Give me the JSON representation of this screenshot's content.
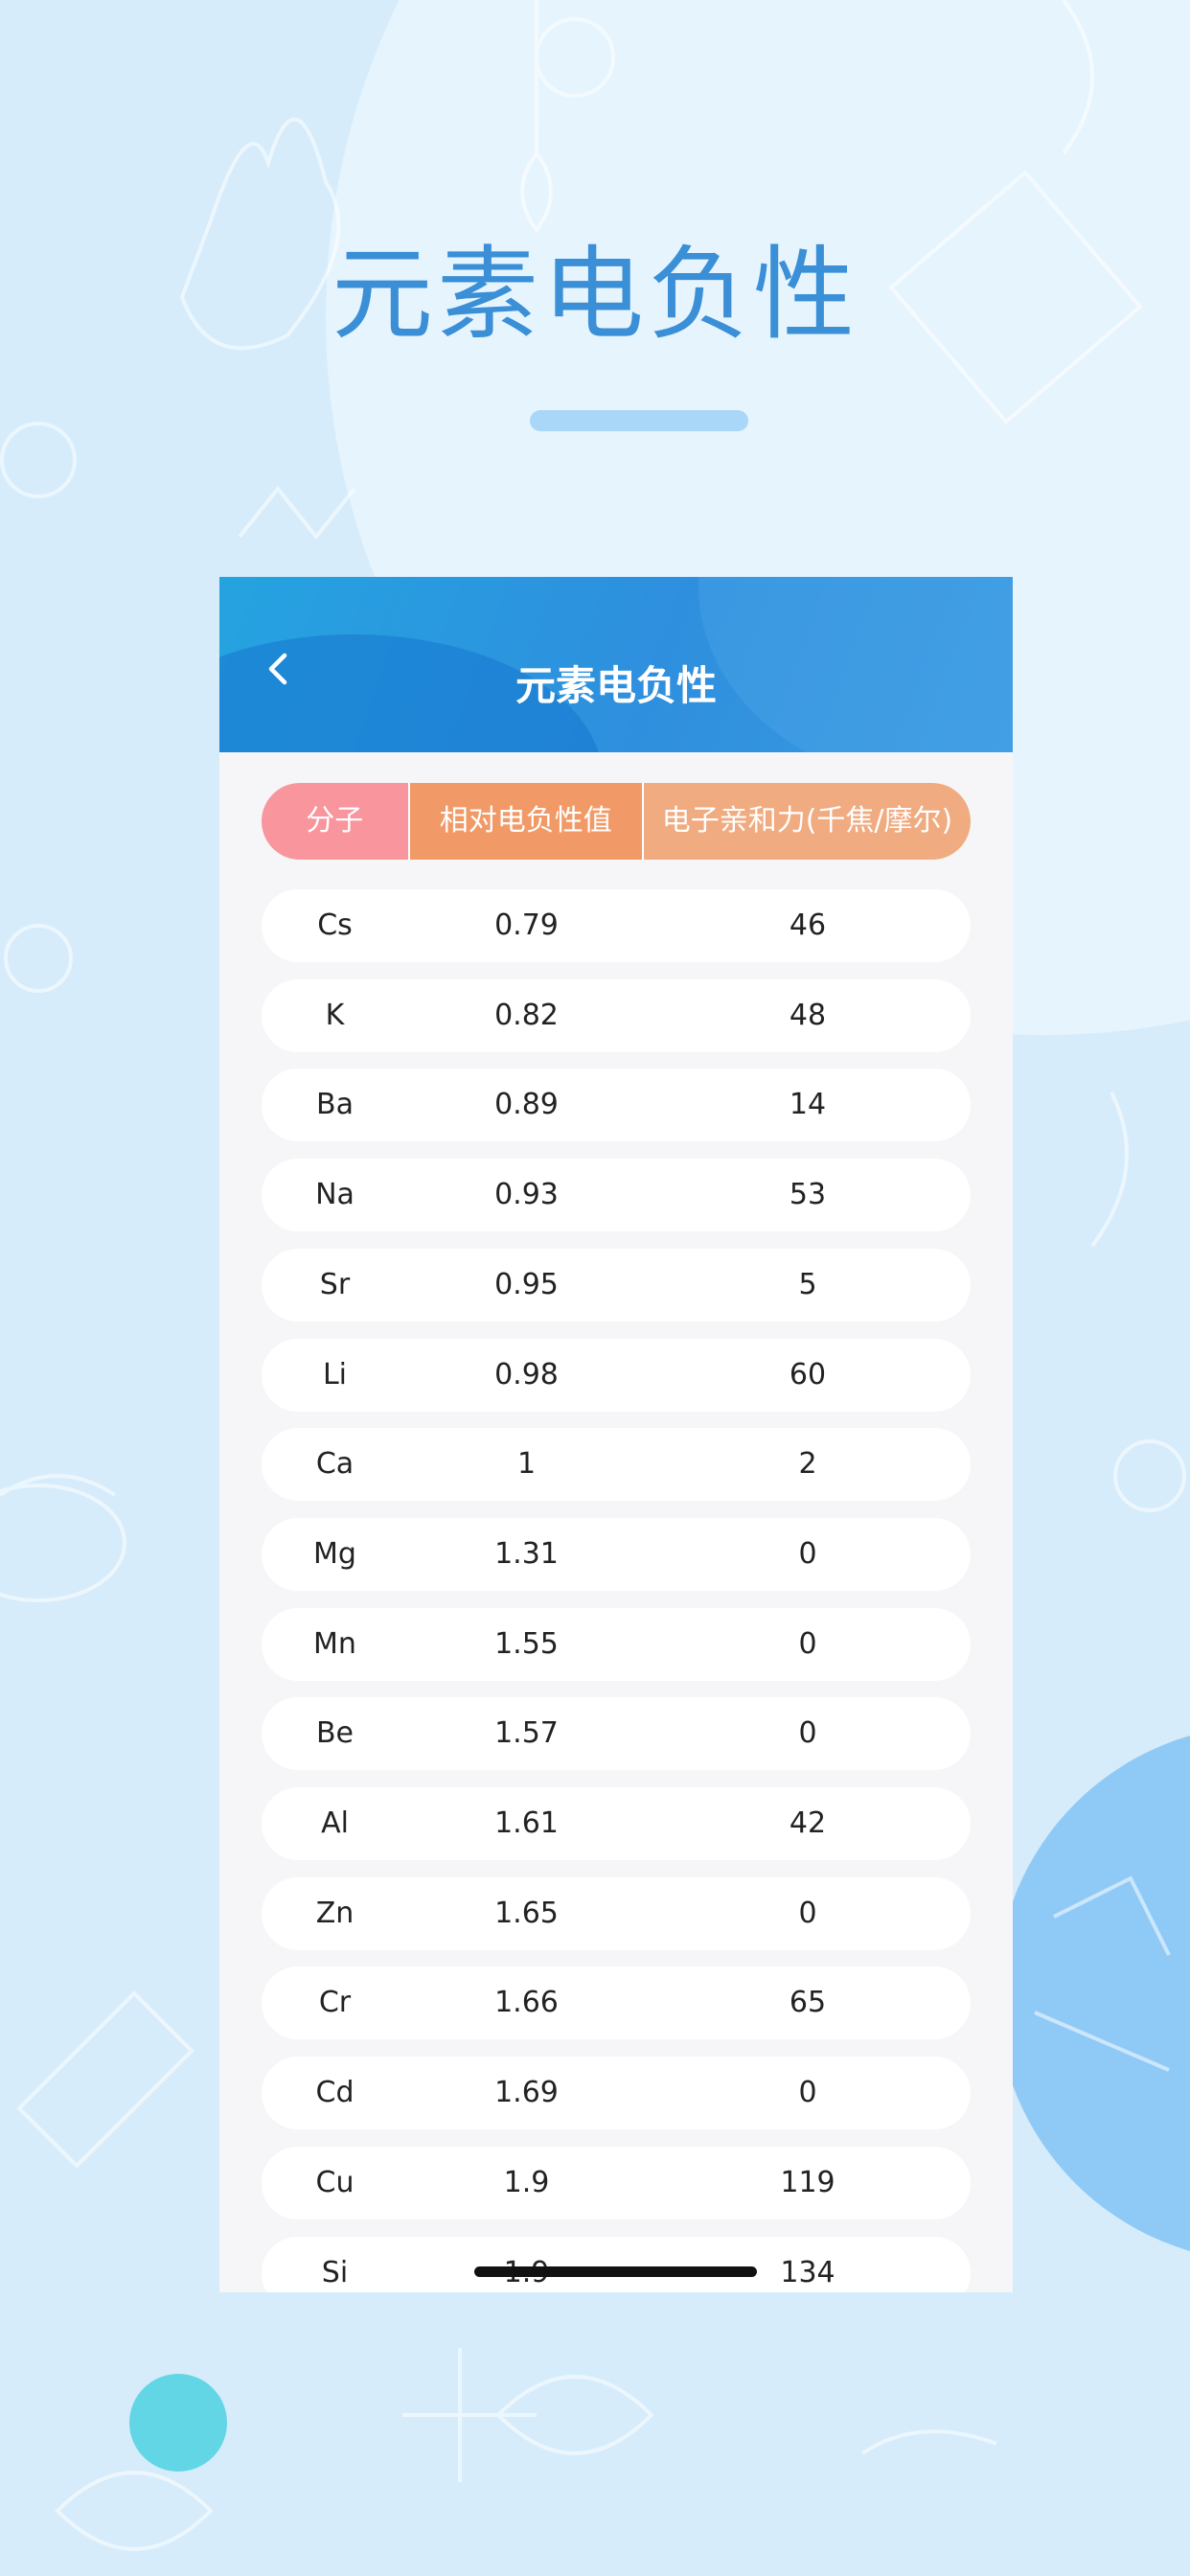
{
  "page_title": "元素电负性",
  "header": {
    "title": "元素电负性",
    "back_icon": "chevron-left-icon"
  },
  "table": {
    "columns": [
      "分子",
      "相对电负性值",
      "电子亲和力(千焦/摩尔)"
    ],
    "rows": [
      {
        "element": "Cs",
        "electronegativity": "0.79",
        "affinity": "46"
      },
      {
        "element": "K",
        "electronegativity": "0.82",
        "affinity": "48"
      },
      {
        "element": "Ba",
        "electronegativity": "0.89",
        "affinity": "14"
      },
      {
        "element": "Na",
        "electronegativity": "0.93",
        "affinity": "53"
      },
      {
        "element": "Sr",
        "electronegativity": "0.95",
        "affinity": "5"
      },
      {
        "element": "Li",
        "electronegativity": "0.98",
        "affinity": "60"
      },
      {
        "element": "Ca",
        "electronegativity": "1",
        "affinity": "2"
      },
      {
        "element": "Mg",
        "electronegativity": "1.31",
        "affinity": "0"
      },
      {
        "element": "Mn",
        "electronegativity": "1.55",
        "affinity": "0"
      },
      {
        "element": "Be",
        "electronegativity": "1.57",
        "affinity": "0"
      },
      {
        "element": "Al",
        "electronegativity": "1.61",
        "affinity": "42"
      },
      {
        "element": "Zn",
        "electronegativity": "1.65",
        "affinity": "0"
      },
      {
        "element": "Cr",
        "electronegativity": "1.66",
        "affinity": "65"
      },
      {
        "element": "Cd",
        "electronegativity": "1.69",
        "affinity": "0"
      },
      {
        "element": "Cu",
        "electronegativity": "1.9",
        "affinity": "119"
      },
      {
        "element": "Si",
        "electronegativity": "1.9",
        "affinity": "134"
      }
    ]
  },
  "colors": {
    "title": "#3a8fd6",
    "header_bg": "#2e8fde",
    "col_molecule": "#f8959d",
    "col_electronegativity": "#f19a67",
    "col_affinity": "#f0ab80"
  }
}
